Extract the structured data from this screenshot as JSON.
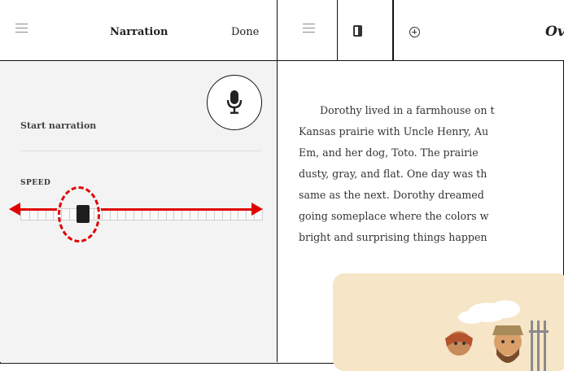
{
  "narration_panel": {
    "title": "Narration",
    "done_label": "Done",
    "start_label": "Start narration",
    "speed_label": "SPEED",
    "speed_value": 0.26
  },
  "toolbar": {
    "title_partial": "Ov"
  },
  "story": {
    "lines": [
      "Dorothy lived in a farmhouse on t",
      "Kansas prairie with Uncle Henry, Au",
      "Em, and her dog, Toto. The prairie",
      "dusty, gray, and flat. One day was th",
      "same as the next. Dorothy dreamed",
      "going someplace where the colors w",
      "bright and surprising things happen"
    ]
  },
  "colors": {
    "annotation": "#e00000",
    "panel_bg": "#f3f3f3",
    "illustration_bg": "#f6e5c6"
  },
  "icons": [
    "menu-icon",
    "microphone-icon",
    "book-panel-icon",
    "add-circle-icon"
  ]
}
